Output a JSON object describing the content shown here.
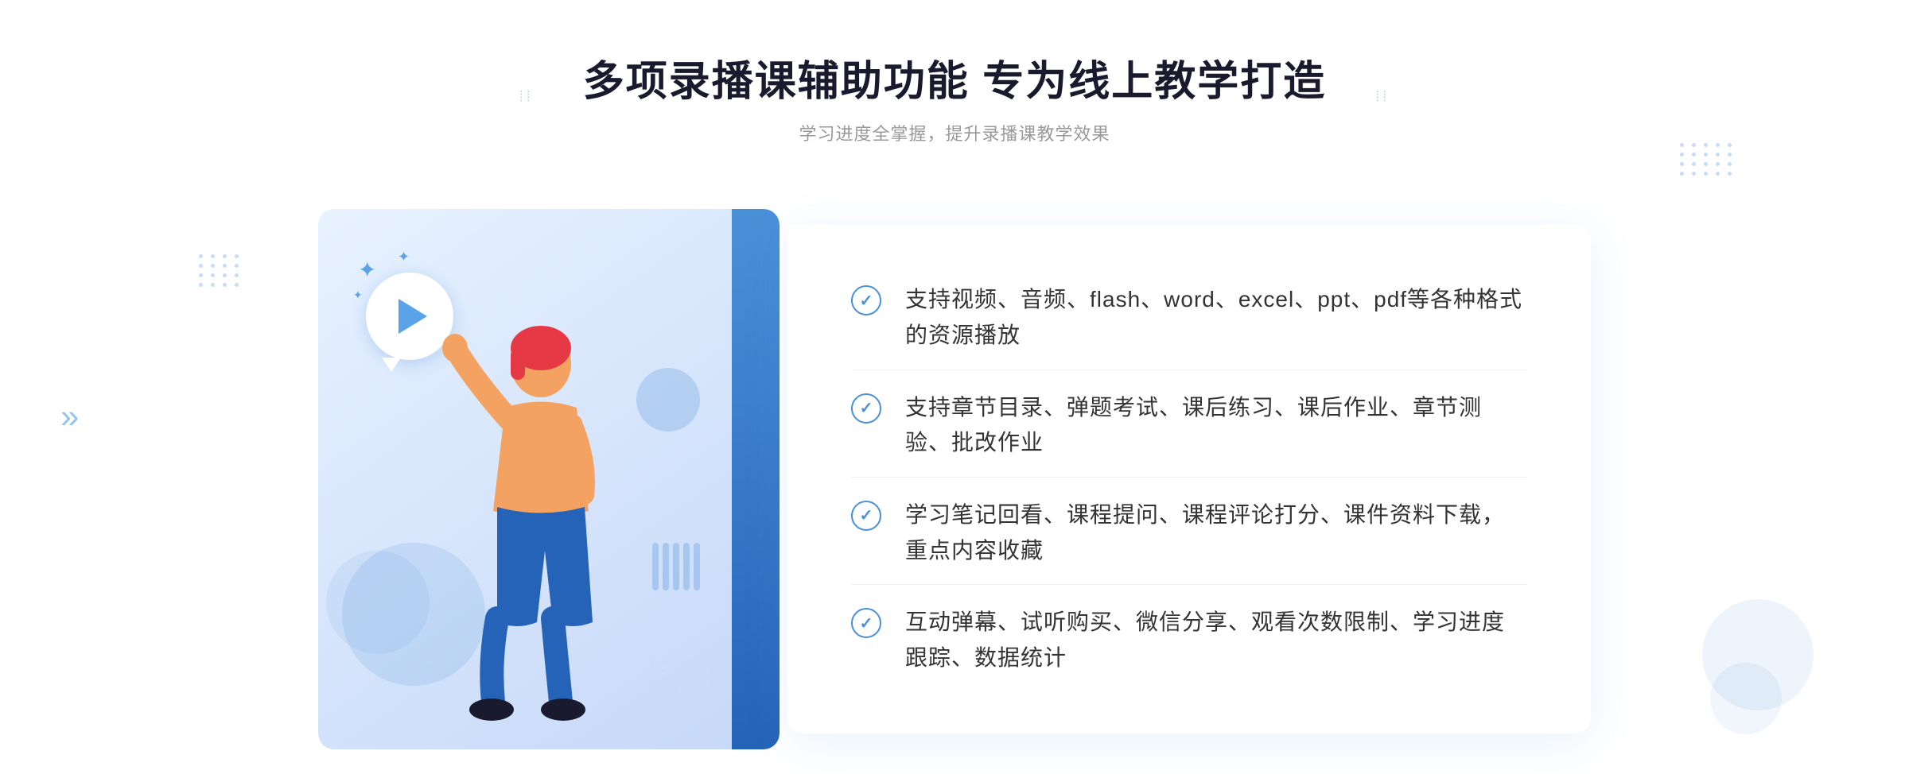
{
  "header": {
    "title": "多项录播课辅助功能 专为线上教学打造",
    "subtitle": "学习进度全掌握，提升录播课教学效果",
    "deco_left": "❋ ❋",
    "deco_right": "❋ ❋"
  },
  "features": [
    {
      "id": 1,
      "text": "支持视频、音频、flash、word、excel、ppt、pdf等各种格式的资源播放"
    },
    {
      "id": 2,
      "text": "支持章节目录、弹题考试、课后练习、课后作业、章节测验、批改作业"
    },
    {
      "id": 3,
      "text": "学习笔记回看、课程提问、课程评论打分、课件资料下载，重点内容收藏"
    },
    {
      "id": 4,
      "text": "互动弹幕、试听购买、微信分享、观看次数限制、学习进度跟踪、数据统计"
    }
  ],
  "chevron": "»",
  "illustration": {
    "alt": "教学插图"
  }
}
